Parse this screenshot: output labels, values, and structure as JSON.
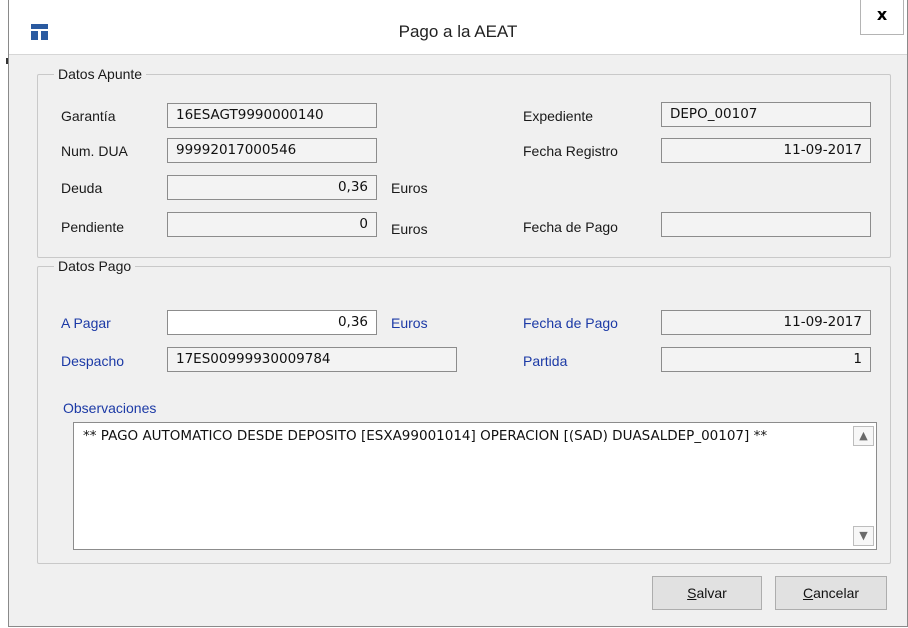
{
  "window": {
    "title": "Pago a la AEAT",
    "close_glyph": "x",
    "icon": "app-grid-icon"
  },
  "datos_apunte": {
    "legend": "Datos Apunte",
    "garantia": {
      "label": "Garantía",
      "value": "16ESAGT9990000140"
    },
    "num_dua": {
      "label": "Num. DUA",
      "value": "99992017000546"
    },
    "deuda": {
      "label": "Deuda",
      "value": "0,36",
      "unit": "Euros"
    },
    "pendiente": {
      "label": "Pendiente",
      "value": "0",
      "unit": "Euros"
    },
    "expediente": {
      "label": "Expediente",
      "value": "DEPO_00107"
    },
    "fecha_registro": {
      "label": "Fecha Registro",
      "value": "11-09-2017"
    },
    "fecha_pago": {
      "label": "Fecha de Pago",
      "value": ""
    }
  },
  "datos_pago": {
    "legend": "Datos Pago",
    "a_pagar": {
      "label": "A Pagar",
      "value": "0,36",
      "unit": "Euros"
    },
    "despacho": {
      "label": "Despacho",
      "value": "17ES00999930009784"
    },
    "fecha_pago": {
      "label": "Fecha de Pago",
      "value": "11-09-2017"
    },
    "partida": {
      "label": "Partida",
      "value": "1"
    },
    "observaciones": {
      "label": "Observaciones",
      "value": "** PAGO AUTOMATICO DESDE DEPOSITO [ESXA99001014] OPERACION [(SAD) DUASALDEP_00107] **"
    }
  },
  "buttons": {
    "salvar": {
      "access_key": "S",
      "rest": "alvar"
    },
    "cancelar": {
      "access_key": "C",
      "rest": "ancelar"
    }
  },
  "colors": {
    "link_label": "#1c3aa6",
    "icon": "#2a5aa0",
    "window_bg": "#f0f0f0"
  }
}
